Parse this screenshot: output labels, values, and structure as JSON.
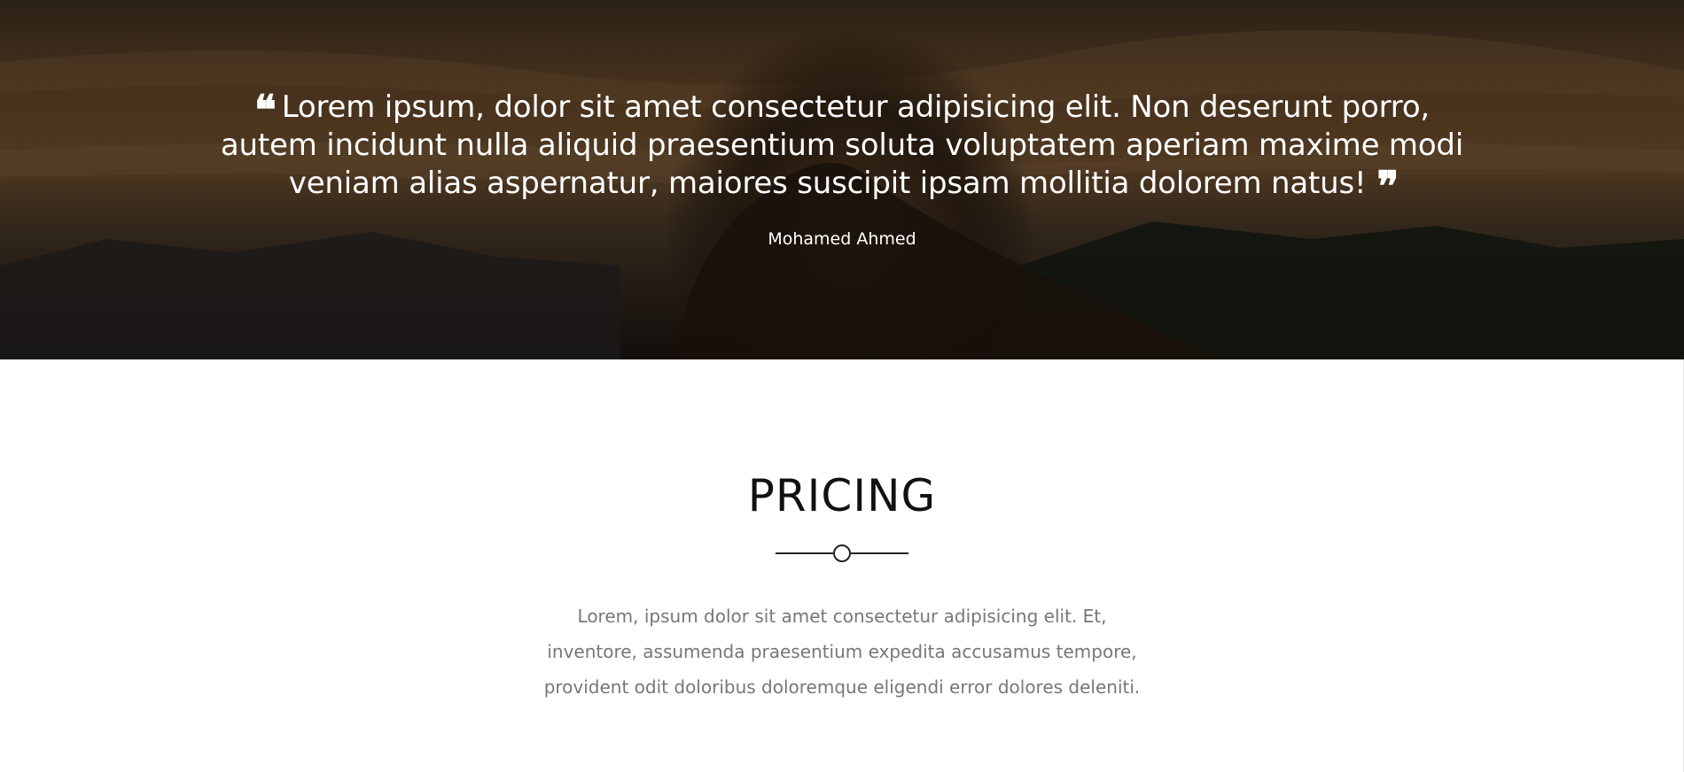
{
  "testimonial": {
    "quote_open_icon": "quote-left-icon",
    "quote_text": "Lorem ipsum, dolor sit amet consectetur adipisicing elit. Non deserunt porro, autem incidunt nulla aliquid praesentium soluta voluptatem aperiam maxime modi veniam alias aspernatur, maiores suscipit ipsam mollitia dolorem natus!",
    "quote_close_icon": "quote-right-icon",
    "author": "Mohamed Ahmed"
  },
  "pricing": {
    "title": "PRICING",
    "divider_icon": "circle-divider-icon",
    "description": "Lorem, ipsum dolor sit amet consectetur adipisicing elit. Et, inventore, assumenda praesentium expedita accusamus tempore, provident odit doloribus doloremque eligendi error dolores deleniti."
  },
  "colors": {
    "hero_overlay": "#000000",
    "text_light": "#ffffff",
    "title": "#111111",
    "description": "#777777"
  }
}
